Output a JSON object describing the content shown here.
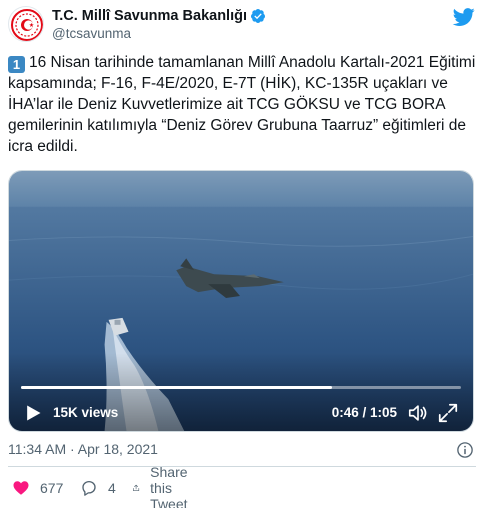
{
  "author": {
    "name": "T.C. Millî Savunma Bakanlığı",
    "handle": "@tcsavunma"
  },
  "tweet": {
    "emoji": "1",
    "text": "16 Nisan tarihinde tamamlanan Millî Anadolu Kartalı-2021 Eğitimi kapsamında; F-16, F-4E/2020, E-7T (HİK), KC-135R uçakları ve İHA’lar ile Deniz Kuvvetlerimize ait TCG GÖKSU ve TCG BORA gemilerinin katılımıyla “Deniz Görev Grubuna Taarruz” eğitimleri de icra edildi."
  },
  "video": {
    "views": "15K views",
    "time": "0:46 / 1:05",
    "progress": 0.7077
  },
  "meta": {
    "timestamp": "11:34 AM · Apr 18, 2021"
  },
  "actions": {
    "likes": "677",
    "replies": "4",
    "share_label": "Share this Tweet"
  },
  "colors": {
    "twitter_blue": "#1d9bf0",
    "like_red": "#f91880",
    "muted": "#536471"
  },
  "icons": {
    "verified": "verified-badge-icon",
    "twitter": "twitter-bird-icon",
    "play": "play-icon",
    "volume": "volume-icon",
    "fullscreen": "fullscreen-icon",
    "info": "info-icon",
    "like": "heart-icon",
    "reply": "reply-icon",
    "share": "share-icon"
  }
}
